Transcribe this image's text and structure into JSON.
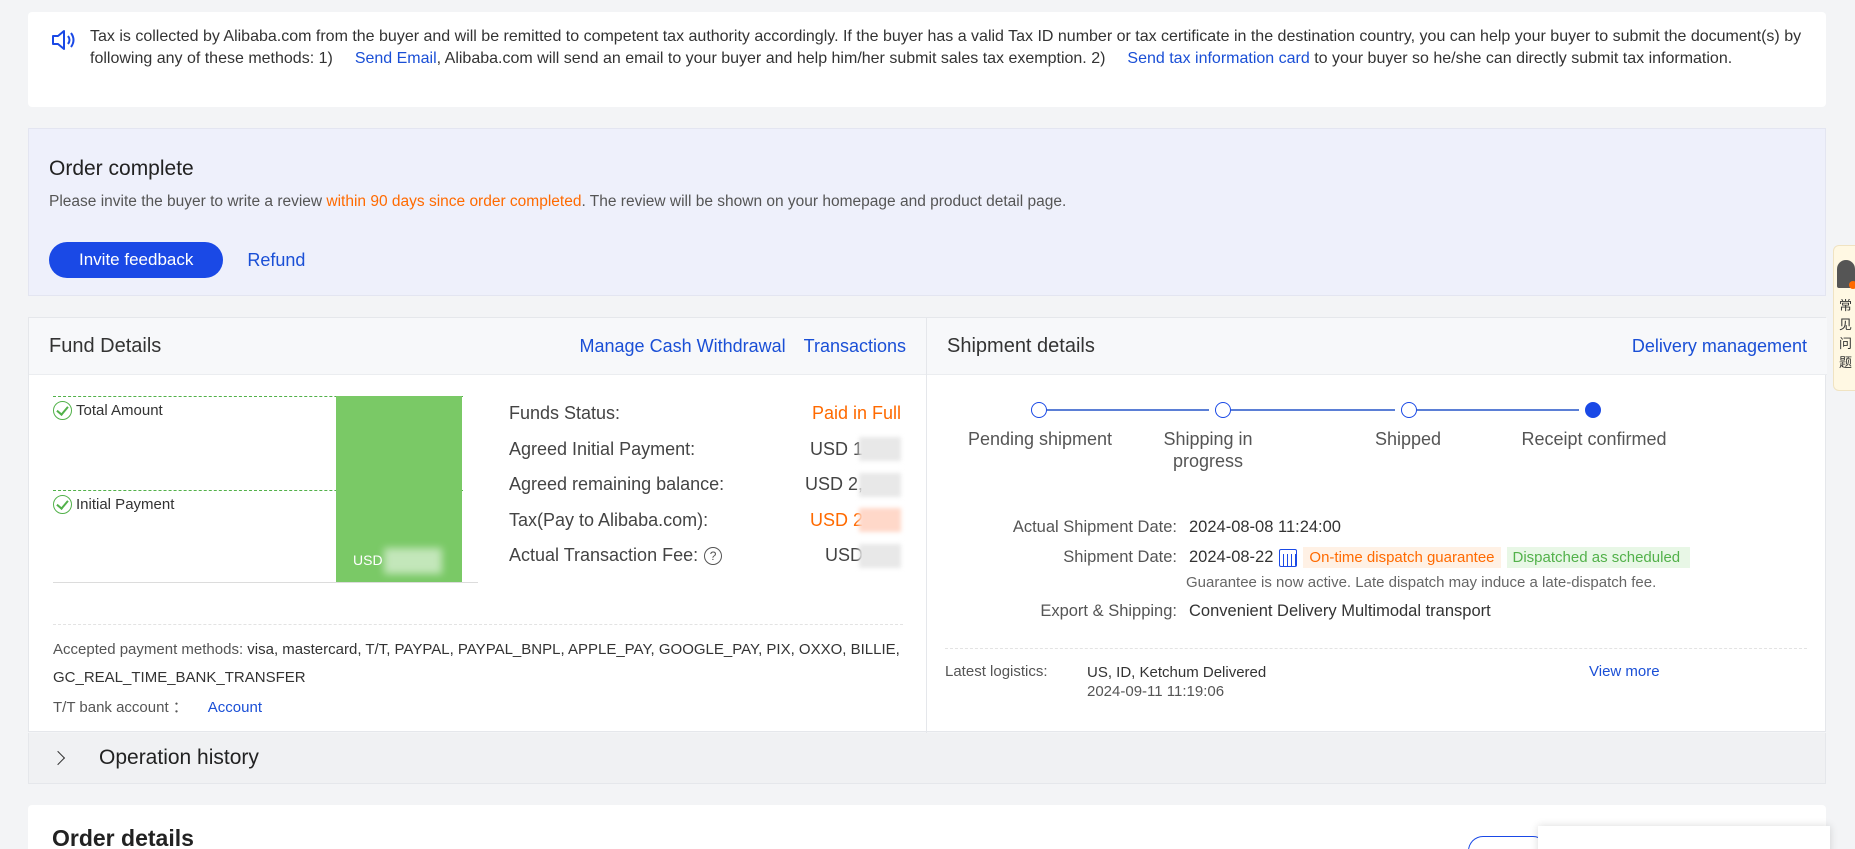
{
  "notice": {
    "text1": "Tax is collected by Alibaba.com from the buyer and will be remitted to competent tax authority accordingly. If the buyer has a valid Tax ID number or tax certificate in the destination country, you can help your buyer to submit the document(s) by following any of these methods: 1)",
    "link1": "Send Email",
    "text2": ", Alibaba.com will send an email to your buyer and help him/her submit sales tax exemption. 2)",
    "link2": "Send tax information card",
    "text3": " to your buyer so he/she can directly submit tax information."
  },
  "order_complete": {
    "title": "Order complete",
    "desc_before": "Please invite the buyer to write a review ",
    "desc_highlight": "within 90 days since order completed",
    "desc_after": ". The review will be shown on your homepage and product detail page.",
    "invite_button": "Invite feedback",
    "refund_link": "Refund"
  },
  "fund": {
    "title": "Fund Details",
    "link_withdraw": "Manage Cash Withdrawal",
    "link_transactions": "Transactions",
    "chart": {
      "total_label": "Total Amount",
      "initial_label": "Initial Payment",
      "bar_label": "USD",
      "paid_fraction": 1.0
    },
    "rows": [
      {
        "label": "Funds Status:",
        "value": "Paid in Full"
      },
      {
        "label": "Agreed Initial Payment:",
        "value": "USD 1"
      },
      {
        "label": "Agreed remaining balance:",
        "value": "USD 2,"
      },
      {
        "label": "Tax(Pay to Alibaba.com):",
        "value": "USD 2"
      },
      {
        "label": "Actual Transaction Fee:",
        "value": "USD"
      }
    ],
    "payment_label": "Accepted payment methods: ",
    "payment_methods": "visa, mastercard, T/T, PAYPAL, PAYPAL_BNPL, APPLE_PAY, GOOGLE_PAY, PIX, OXXO, BILLIE, GC_REAL_TIME_BANK_TRANSFER",
    "bank_label": "T/T bank account ：",
    "bank_link": "Account"
  },
  "shipment": {
    "title": "Shipment details",
    "link_delivery": "Delivery management",
    "steps": [
      "Pending shipment",
      "Shipping in progress",
      "Shipped",
      "Receipt confirmed"
    ],
    "actual_date_label": "Actual Shipment Date:",
    "actual_date": "2024-08-08 11:24:00",
    "date_label": "Shipment Date:",
    "date": "2024-08-22",
    "tag_guarantee": "On-time dispatch guarantee",
    "tag_dispatched": "Dispatched as scheduled",
    "guarantee_note": "Guarantee is now active. Late dispatch may induce a late-dispatch fee.",
    "export_label": "Export & Shipping:",
    "export_value": "Convenient Delivery Multimodal transport",
    "logistics_label": "Latest logistics:",
    "logistics_location": "US, ID, Ketchum  Delivered",
    "logistics_time": "2024-09-11 11:19:06",
    "view_more": "View more"
  },
  "operation_history": "Operation history",
  "order_details": "Order details",
  "float_widget_text": "常见问题"
}
